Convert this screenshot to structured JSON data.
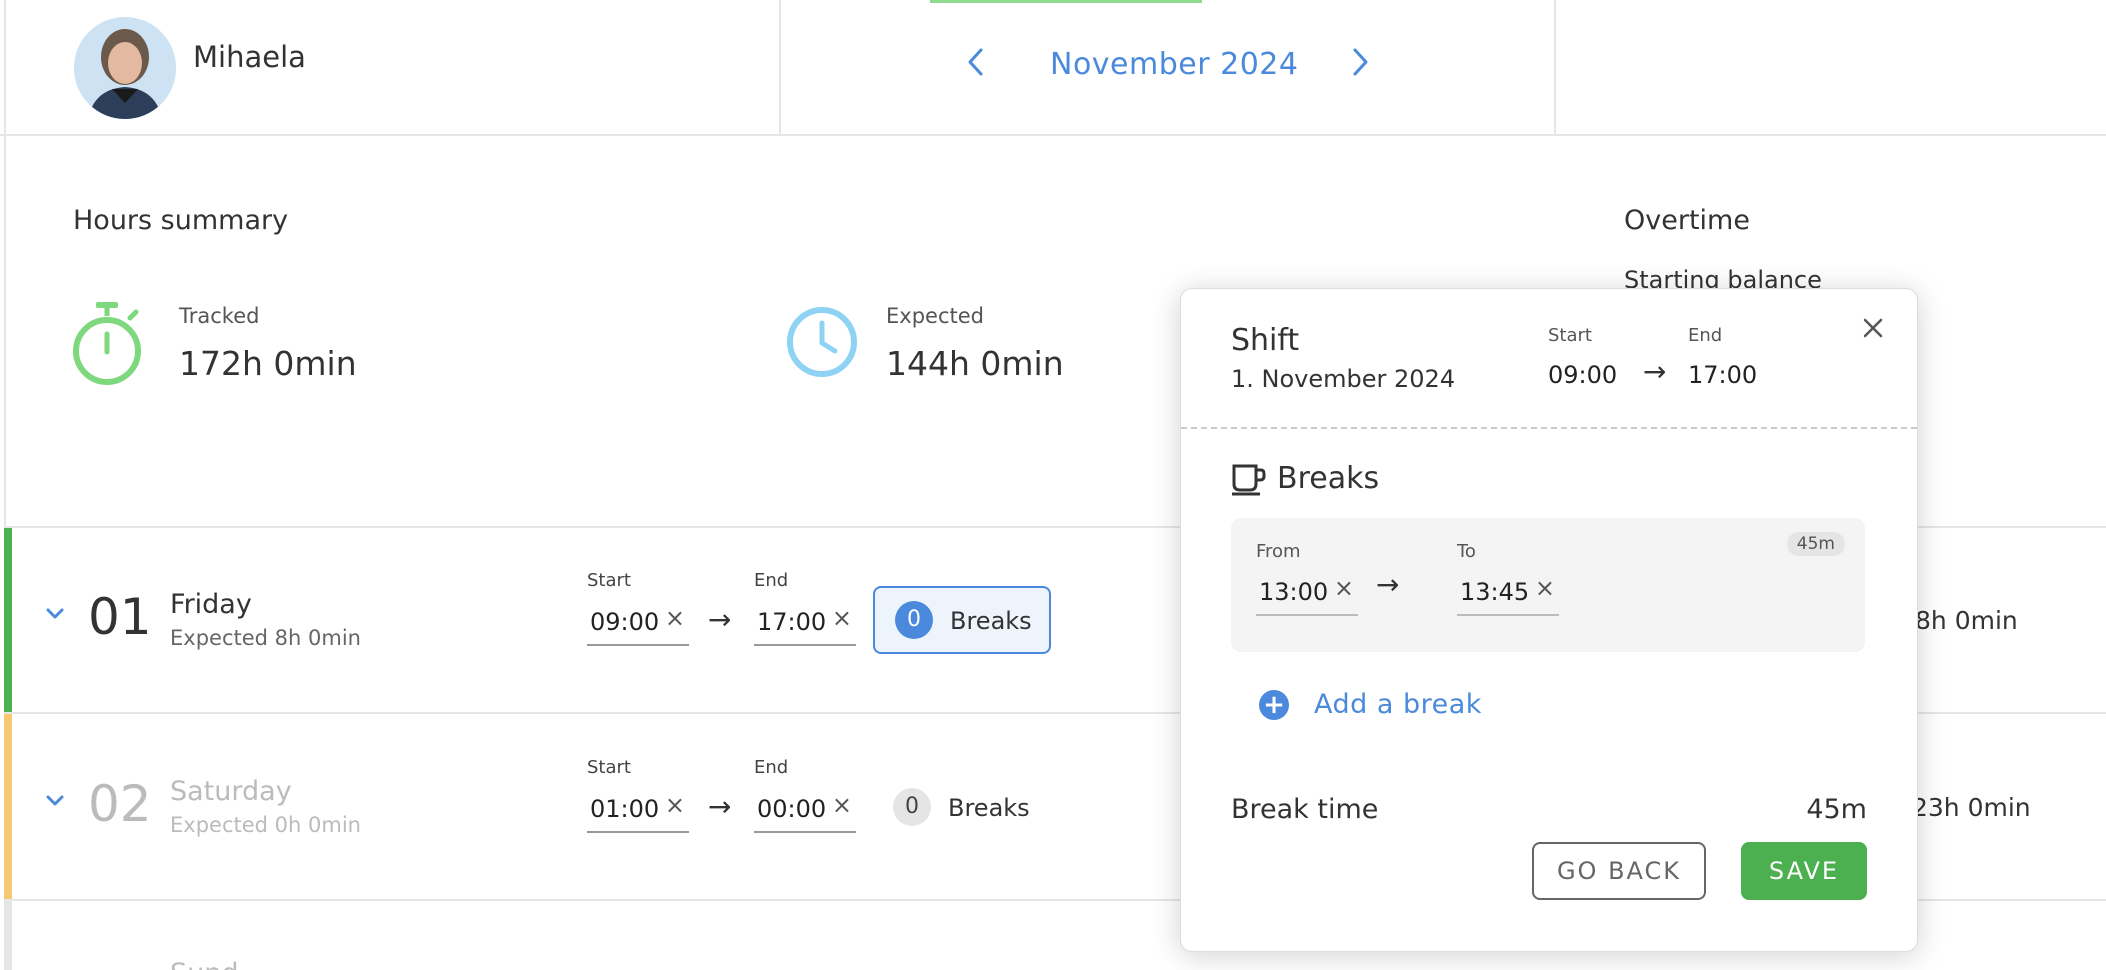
{
  "header": {
    "user_name": "Mihaela",
    "month": "November 2024",
    "prev_icon": "chevron-left-icon",
    "next_icon": "chevron-right-icon",
    "accent_color": "#4a89dc"
  },
  "summary": {
    "title": "Hours summary",
    "tracked": {
      "label": "Tracked",
      "value": "172h 0min"
    },
    "expected": {
      "label": "Expected",
      "value": "144h 0min"
    },
    "overtime": {
      "title": "Overtime",
      "starting_balance": "Starting balance"
    }
  },
  "days": [
    {
      "num": "01",
      "name": "Friday",
      "expected": "Expected 8h 0min",
      "start_label": "Start",
      "start": "09:00",
      "end_label": "End",
      "end": "17:00",
      "break_count": "0",
      "breaks_label": "Breaks",
      "right_total": "8h 0min",
      "accent": "#4caf50"
    },
    {
      "num": "02",
      "name": "Saturday",
      "expected": "Expected 0h 0min",
      "start_label": "Start",
      "start": "01:00",
      "end_label": "End",
      "end": "00:00",
      "break_count": "0",
      "breaks_label": "Breaks",
      "right_total": "23h 0min",
      "accent": "#f7c873"
    },
    {
      "partial_name": "Sund"
    }
  ],
  "modal": {
    "title": "Shift",
    "date": "1. November 2024",
    "start_label": "Start",
    "start": "09:00",
    "end_label": "End",
    "end": "17:00",
    "breaks_title": "Breaks",
    "break": {
      "from_label": "From",
      "from": "13:00",
      "to_label": "To",
      "to": "13:45",
      "duration": "45m"
    },
    "add_break": "Add a break",
    "break_time_label": "Break time",
    "break_time_value": "45m",
    "go_back": "GO BACK",
    "save": "SAVE"
  }
}
